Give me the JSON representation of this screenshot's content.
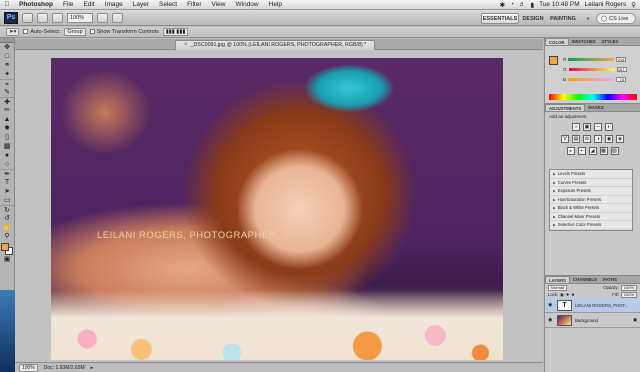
{
  "macmenu": {
    "app": "Photoshop",
    "items": [
      "File",
      "Edit",
      "Image",
      "Layer",
      "Select",
      "Filter",
      "View",
      "Window",
      "Help"
    ],
    "clock": "Tue 10:48 PM",
    "user": "Leilani Rogers"
  },
  "appbar": {
    "zoom": "100%",
    "workspaces": [
      "ESSENTIALS",
      "DESIGN",
      "PAINTING"
    ],
    "more": "»",
    "cs_live": "CS Live"
  },
  "options": {
    "auto_select_label": "Auto-Select:",
    "auto_select_value": "Group",
    "transform_label": "Show Transform Controls"
  },
  "document": {
    "tab_title": "_DSC0091.jpg @ 100% (LEILANI ROGERS, PHOTOGRAPHER, RGB/8) *",
    "watermark": "LEILANI ROGERS, PHOTOGRAPHER",
    "status_zoom": "100%",
    "status_doc": "Doc: 1.93M/2.65M"
  },
  "color_panel": {
    "tabs": [
      "COLOR",
      "SWATCHES",
      "STYLES"
    ],
    "channels": [
      {
        "label": "R",
        "value": "244"
      },
      {
        "label": "G",
        "value": "163"
      },
      {
        "label": "B",
        "value": "78"
      }
    ],
    "foreground": "#f6a24c"
  },
  "adjustments_panel": {
    "tabs": [
      "ADJUSTMENTS",
      "MASKS"
    ],
    "add_label": "Add an adjustment",
    "presets": [
      "Levels Presets",
      "Curves Presets",
      "Exposure Presets",
      "Hue/Saturation Presets",
      "Black & White Presets",
      "Channel Mixer Presets",
      "Selective Color Presets"
    ]
  },
  "layers_panel": {
    "tabs": [
      "LAYERS",
      "CHANNELS",
      "PATHS"
    ],
    "blend_mode": "Normal",
    "opacity_label": "Opacity:",
    "opacity": "100%",
    "lock_label": "Lock:",
    "fill_label": "Fill:",
    "fill": "100%",
    "layers": [
      {
        "name": "LEILANI ROGERS, PHOT...",
        "type": "text"
      },
      {
        "name": "Background",
        "type": "image"
      }
    ]
  }
}
